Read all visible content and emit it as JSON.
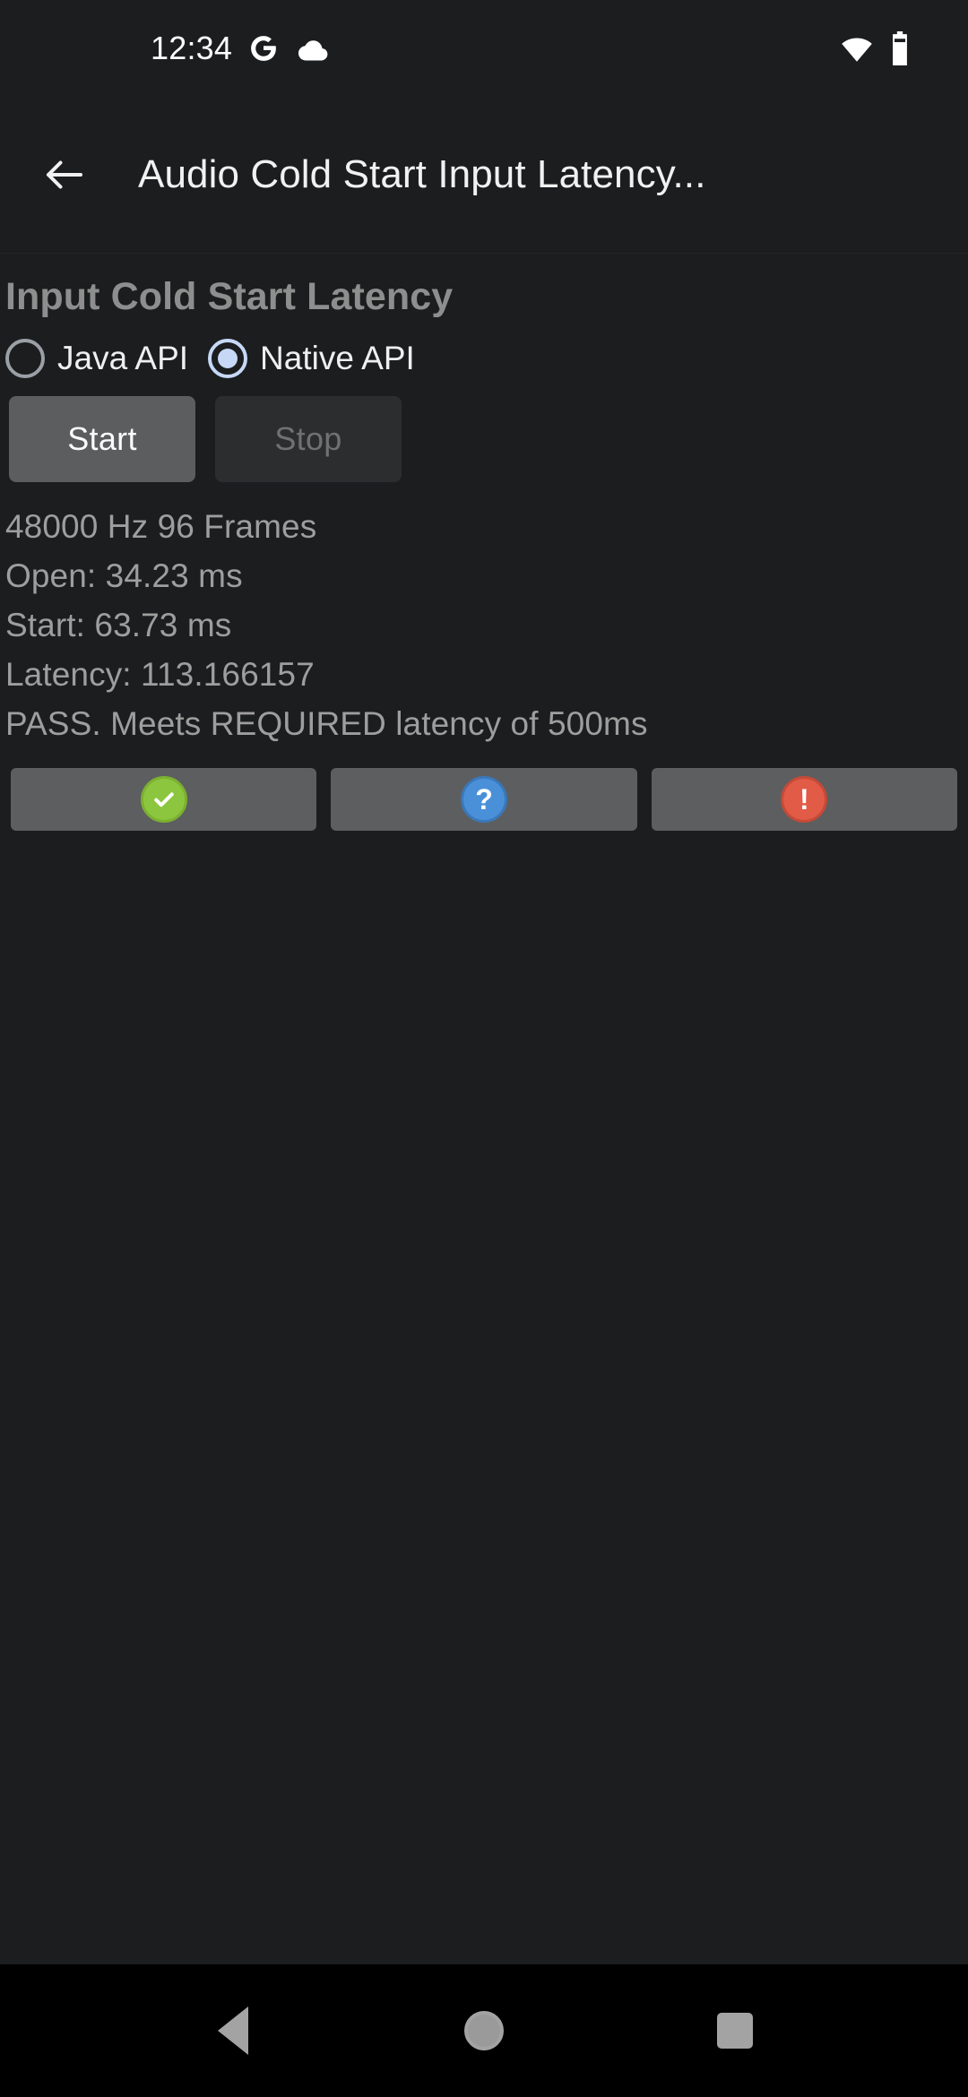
{
  "status_bar": {
    "clock": "12:34",
    "icons": [
      "google-g-icon",
      "cloud-icon",
      "wifi-icon",
      "battery-icon"
    ]
  },
  "app_bar": {
    "back_icon": "back-arrow-icon",
    "title": "Audio Cold Start Input Latency..."
  },
  "main": {
    "heading": "Input Cold Start Latency",
    "radio_options": [
      {
        "label": "Java API",
        "checked": false
      },
      {
        "label": "Native API",
        "checked": true
      }
    ],
    "buttons": [
      {
        "label": "Start",
        "enabled": true
      },
      {
        "label": "Stop",
        "enabled": false
      }
    ],
    "results": [
      "48000 Hz 96 Frames",
      "Open: 34.23 ms",
      "Start: 63.73 ms",
      "Latency: 113.166157",
      "PASS. Meets REQUIRED latency of 500ms"
    ],
    "icon_buttons": [
      {
        "name": "pass-button",
        "glyph": "check",
        "color": "#8cc63e"
      },
      {
        "name": "info-button",
        "glyph": "?",
        "color": "#4a90d9"
      },
      {
        "name": "fail-button",
        "glyph": "!",
        "color": "#e25b47"
      }
    ]
  },
  "nav_bar": {
    "back_label": "Back",
    "home_label": "Home",
    "recents_label": "Recents"
  },
  "colors": {
    "background": "#1b1d1e",
    "nav_background": "#000000",
    "accent_radio": "#c6d8f6",
    "text_primary": "#efefef",
    "text_secondary": "#9e9e9e",
    "heading": "#8e8e8e",
    "button_enabled": "#5b5d5f",
    "button_disabled": "#2b2d2f"
  }
}
